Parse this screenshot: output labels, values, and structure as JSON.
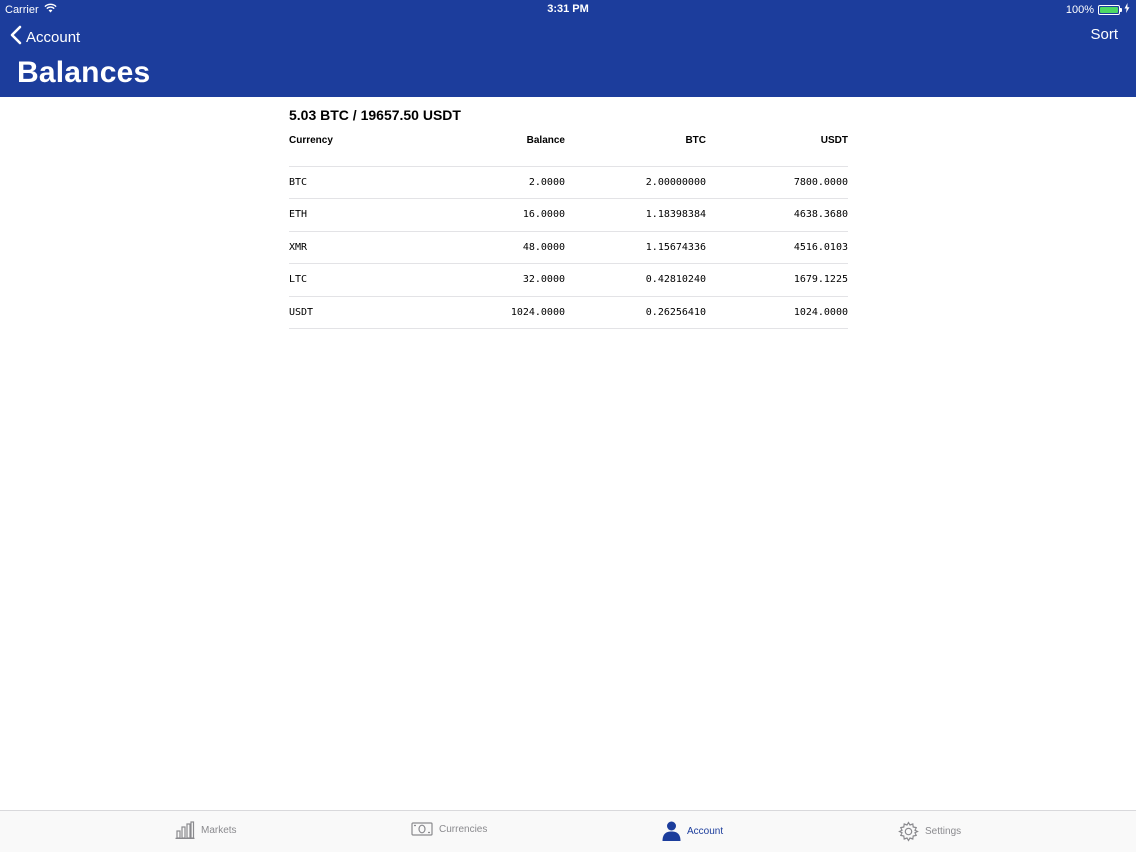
{
  "status_bar": {
    "carrier": "Carrier",
    "time": "3:31 PM",
    "battery": "100%"
  },
  "nav": {
    "back_label": "Account",
    "sort_label": "Sort",
    "title": "Balances"
  },
  "summary": "5.03 BTC / 19657.50 USDT",
  "table": {
    "headers": [
      "Currency",
      "Balance",
      "BTC",
      "USDT"
    ],
    "rows": [
      [
        "BTC",
        "2.0000",
        "2.00000000",
        "7800.0000"
      ],
      [
        "ETH",
        "16.0000",
        "1.18398384",
        "4638.3680"
      ],
      [
        "XMR",
        "48.0000",
        "1.15674336",
        "4516.0103"
      ],
      [
        "LTC",
        "32.0000",
        "0.42810240",
        "1679.1225"
      ],
      [
        "USDT",
        "1024.0000",
        "0.26256410",
        "1024.0000"
      ]
    ]
  },
  "tabs": [
    {
      "label": "Markets",
      "icon": "bar-chart-icon"
    },
    {
      "label": "Currencies",
      "icon": "banknote-icon"
    },
    {
      "label": "Account",
      "icon": "person-icon",
      "active": true
    },
    {
      "label": "Settings",
      "icon": "gear-icon"
    }
  ],
  "colors": {
    "brand": "#1c3d9c",
    "battery": "#4cd964",
    "tab_inactive": "#8a8a8e"
  }
}
